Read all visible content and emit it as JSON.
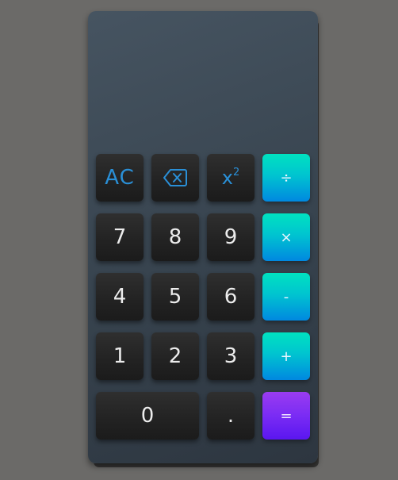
{
  "display": {
    "value": ""
  },
  "keys": {
    "clear": "AC",
    "backspace_icon": "backspace-icon",
    "square_base": "x",
    "square_exp": "2",
    "divide": "÷",
    "seven": "7",
    "eight": "8",
    "nine": "9",
    "multiply": "×",
    "four": "4",
    "five": "5",
    "six": "6",
    "minus": "-",
    "one": "1",
    "two": "2",
    "three": "3",
    "plus": "+",
    "zero": "0",
    "decimal": ".",
    "equals": "="
  },
  "colors": {
    "background": "#6b6a68",
    "body": "#3d4853",
    "key_dark": "#262626",
    "function_text": "#2a8fd6",
    "operator_top": "#00e2c0",
    "operator_bottom": "#0088e0",
    "equals_top": "#9a3cf0",
    "equals_bottom": "#5a16f0"
  }
}
